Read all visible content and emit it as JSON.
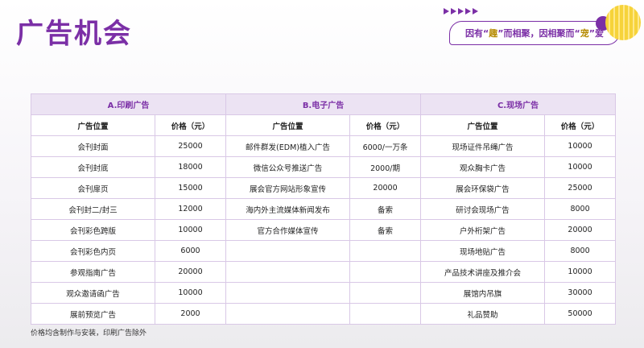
{
  "page_title": "广告机会",
  "slogan": {
    "pre": "因有“",
    "hl1": "趣",
    "mid": "”而相聚，因相聚而“",
    "hl2": "宠",
    "post": "”爱"
  },
  "accent_color": "#7b2fa6",
  "groups": [
    "A.印刷广告",
    "B.电子广告",
    "C.现场广告"
  ],
  "col_position": "广告位置",
  "col_price": "价格（元）",
  "rows": [
    [
      "会刊封面",
      "25000",
      "邮件群发(EDM)植入广告",
      "6000/一万条",
      "现场证件吊绳广告",
      "10000"
    ],
    [
      "会刊封底",
      "18000",
      "微信公众号推送广告",
      "2000/期",
      "观众胸卡广告",
      "10000"
    ],
    [
      "会刊扉页",
      "15000",
      "展会官方网站形象宣传",
      "20000",
      "展会环保袋广告",
      "25000"
    ],
    [
      "会刊封二/封三",
      "12000",
      "海内外主流媒体新闻发布",
      "备索",
      "研讨会现场广告",
      "8000"
    ],
    [
      "会刊彩色跨版",
      "10000",
      "官方合作媒体宣传",
      "备索",
      "户外桁架广告",
      "20000"
    ],
    [
      "会刊彩色内页",
      "6000",
      "",
      "",
      "现场地贴广告",
      "8000"
    ],
    [
      "参观指南广告",
      "20000",
      "",
      "",
      "产品技术讲座及推介会",
      "10000"
    ],
    [
      "观众邀请函广告",
      "10000",
      "",
      "",
      "展馆内吊旗",
      "30000"
    ],
    [
      "展前预览广告",
      "2000",
      "",
      "",
      "礼品赞助",
      "50000"
    ]
  ],
  "footnote": "价格均含制作与安装，印刷广告除外"
}
